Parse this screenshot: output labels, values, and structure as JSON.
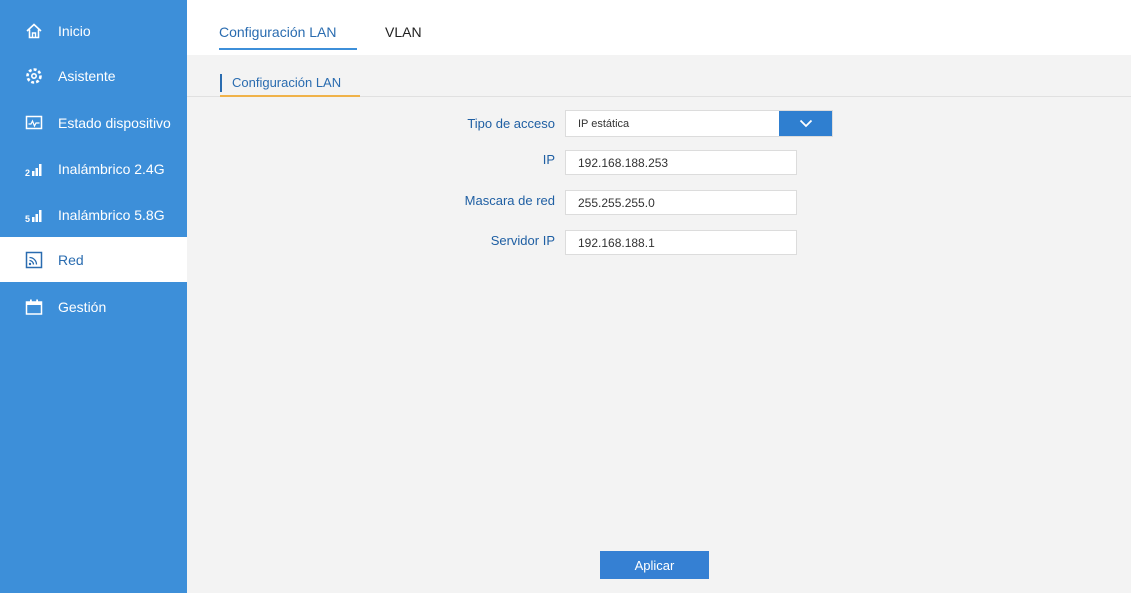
{
  "sidebar": {
    "items": [
      {
        "label": "Inicio",
        "icon": "home-icon"
      },
      {
        "label": "Asistente",
        "icon": "gear-icon"
      },
      {
        "label": "Estado dispositivo",
        "icon": "monitor-icon"
      },
      {
        "label": "Inalámbrico 2.4G",
        "icon": "signal-2g-icon",
        "badge": "2"
      },
      {
        "label": "Inalámbrico 5.8G",
        "icon": "signal-5g-icon",
        "badge": "5"
      },
      {
        "label": "Red",
        "icon": "network-icon",
        "active": true
      },
      {
        "label": "Gestión",
        "icon": "management-icon"
      }
    ]
  },
  "tabs": [
    {
      "label": "Configuración LAN",
      "active": true
    },
    {
      "label": "VLAN",
      "active": false
    }
  ],
  "section": {
    "title": "Configuración LAN"
  },
  "form": {
    "access_type": {
      "label": "Tipo de acceso",
      "value": "IP estática"
    },
    "ip": {
      "label": "IP",
      "value": "192.168.188.253"
    },
    "netmask": {
      "label": "Mascara de red",
      "value": "255.255.255.0"
    },
    "server_ip": {
      "label": "Servidor IP",
      "value": "192.168.188.1"
    }
  },
  "actions": {
    "apply_label": "Aplicar"
  },
  "colors": {
    "sidebar_bg": "#3d8fd9",
    "accent": "#2a6cb0",
    "button": "#3580d3",
    "section_underline": "#f0b249",
    "content_bg": "#f3f3f3"
  }
}
